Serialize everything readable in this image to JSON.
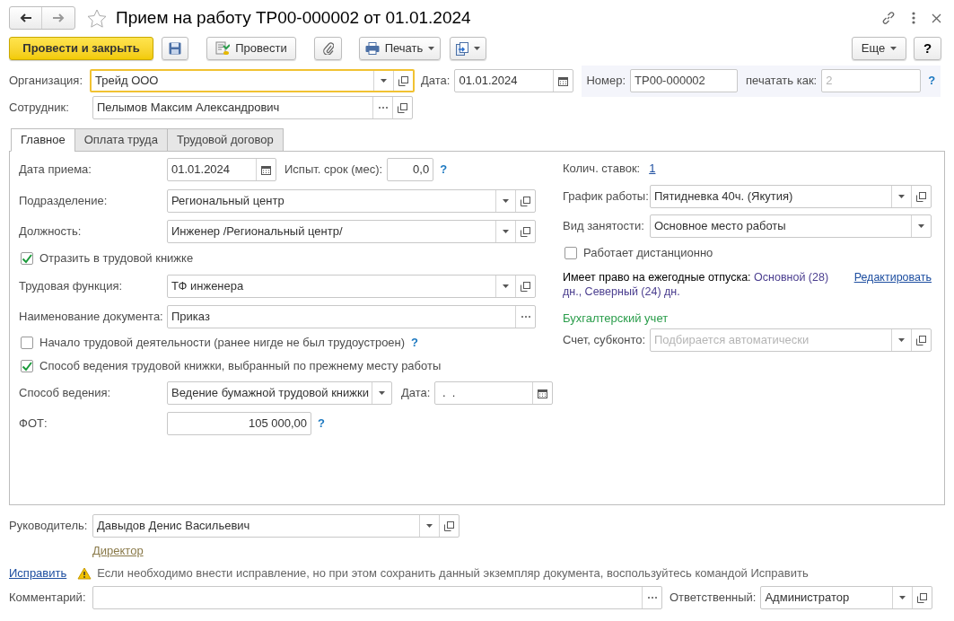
{
  "header": {
    "title": "Прием на работу ТР00-000002 от 01.01.2024",
    "favorite": false
  },
  "toolbar": {
    "post_and_close": "Провести и закрыть",
    "post": "Провести",
    "print": "Печать",
    "more": "Еще",
    "help": "?"
  },
  "organization": {
    "label": "Организация:",
    "value": "Трейд ООО",
    "focused": true
  },
  "date": {
    "label": "Дата:",
    "value": "01.01.2024"
  },
  "number": {
    "label": "Номер:",
    "value": "ТР00-000002"
  },
  "print_as": {
    "label": "печатать как:",
    "placeholder": "2",
    "help": "?"
  },
  "employee": {
    "label": "Сотрудник:",
    "value": "Пелымов Максим Александрович"
  },
  "tabs": [
    {
      "label": "Главное",
      "selected": true
    },
    {
      "label": "Оплата труда",
      "selected": false
    },
    {
      "label": "Трудовой договор",
      "selected": false
    }
  ],
  "main": {
    "hire_date": {
      "label": "Дата приема:",
      "value": "01.01.2024"
    },
    "probation": {
      "label": "Испыт. срок (мес):",
      "value": "0,0",
      "help": "?"
    },
    "department": {
      "label": "Подразделение:",
      "value": "Региональный центр"
    },
    "position": {
      "label": "Должность:",
      "value": "Инженер /Региональный центр/"
    },
    "reflect_in_book": {
      "label": "Отразить в трудовой книжке",
      "checked": true
    },
    "labor_function": {
      "label": "Трудовая функция:",
      "value": "ТФ инженера"
    },
    "document_name": {
      "label": "Наименование документа:",
      "value": "Приказ"
    },
    "career_start": {
      "label": "Начало трудовой деятельности (ранее нигде не был трудоустроен)",
      "checked": false,
      "help": "?"
    },
    "book_method_prev": {
      "label": "Способ ведения трудовой книжки, выбранный по прежнему месту работы",
      "checked": true
    },
    "book_method": {
      "label": "Способ ведения:",
      "value": "Ведение бумажной трудовой книжки"
    },
    "book_date": {
      "label": "Дата:",
      "value": " .  ."
    },
    "payroll": {
      "label": "ФОТ:",
      "value": "105 000,00",
      "help": "?"
    },
    "rates": {
      "label": "Колич. ставок:",
      "value": "1"
    },
    "schedule": {
      "label": "График работы:",
      "value": "Пятидневка 40ч. (Якутия)"
    },
    "employment": {
      "label": "Вид занятости:",
      "value": "Основное место работы"
    },
    "remote": {
      "label": "Работает дистанционно",
      "checked": false
    },
    "vacation": {
      "label": "Имеет право на ежегодные отпуска:",
      "value": "Основной (28) дн., Северный (24) дн.",
      "edit_link": "Редактировать"
    },
    "accounting": {
      "heading": "Бухгалтерский учет",
      "label": "Счет, субконто:",
      "placeholder": "Подбирается автоматически"
    }
  },
  "manager": {
    "label": "Руководитель:",
    "value": "Давыдов Денис Васильевич",
    "position_link": "Директор"
  },
  "correction": {
    "link": "Исправить",
    "message": "Если необходимо внести исправление, но при этом сохранить данный экземпляр документа, воспользуйтесь командой Исправить"
  },
  "comment": {
    "label": "Комментарий:"
  },
  "responsible": {
    "label": "Ответственный:",
    "value": "Администратор"
  }
}
